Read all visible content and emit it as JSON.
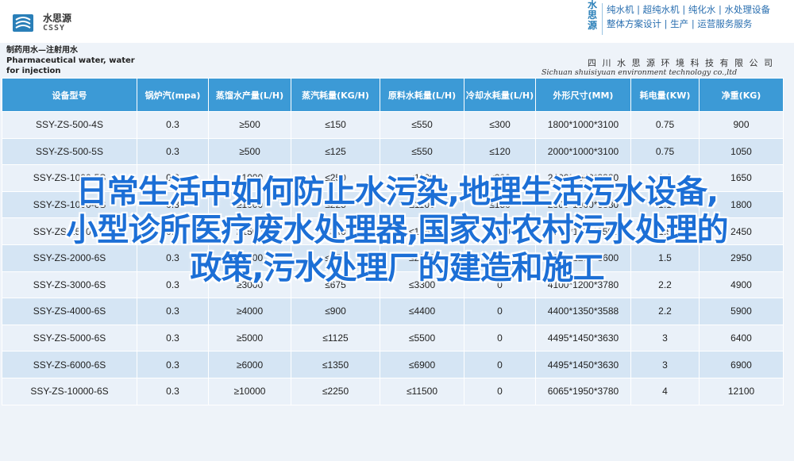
{
  "header": {
    "brand_name": "水思源",
    "brand_sub": "CSSY",
    "right_logo": "水思源",
    "right_lines": [
      "纯水机 | 超纯水机 | 纯化水 | 水处理设备",
      "整体方案设计 | 生产 | 运营服务服务"
    ]
  },
  "table": {
    "title_cn": "制药用水—注射用水",
    "title_en": "Pharmaceutical water, water for injection",
    "company_cn": "四 川 水 思 源 环 境 科 技 有 限 公 司",
    "company_en": "Sichuan shuisiyuan environment technology co.,ltd",
    "columns": [
      "设备型号",
      "锅炉汽(mpa)",
      "蒸馏水产量(L/H)",
      "蒸汽耗量(KG/H)",
      "原料水耗量(L/H)",
      "冷却水耗量(L/H)",
      "外形尺寸(MM)",
      "耗电量(KW)",
      "净重(KG)"
    ],
    "rows": [
      [
        "SSY-ZS-500-4S",
        "0.3",
        "≥500",
        "≤150",
        "≤550",
        "≤300",
        "1800*1000*3100",
        "0.75",
        "900"
      ],
      [
        "SSY-ZS-500-5S",
        "0.3",
        "≥500",
        "≤125",
        "≤550",
        "≤120",
        "2000*1000*3100",
        "0.75",
        "1050"
      ],
      [
        "SSY-ZS-1000-5S",
        "0.3",
        "≥1000",
        "≤250",
        "≤1100",
        "≤200",
        "2200*1000*3380",
        "1.1",
        "1650"
      ],
      [
        "SSY-ZS-1000-6S",
        "0.3",
        "≥1000",
        "≤225",
        "≤1100",
        "≤150",
        "2300*1000*3380",
        "1.1",
        "1800"
      ],
      [
        "SSY-ZS-1500-6S",
        "0.3",
        "≥1500",
        "≤340",
        "≤1650",
        "≤230",
        "2600*1100*3500",
        "1.5",
        "2450"
      ],
      [
        "SSY-ZS-2000-6S",
        "0.3",
        "≥2000",
        "≤450",
        "≤2200",
        "≤300",
        "3000*1200*3600",
        "1.5",
        "2950"
      ],
      [
        "SSY-ZS-3000-6S",
        "0.3",
        "≥3000",
        "≤675",
        "≤3300",
        "0",
        "4100*1200*3780",
        "2.2",
        "4900"
      ],
      [
        "SSY-ZS-4000-6S",
        "0.3",
        "≥4000",
        "≤900",
        "≤4400",
        "0",
        "4400*1350*3588",
        "2.2",
        "5900"
      ],
      [
        "SSY-ZS-5000-6S",
        "0.3",
        "≥5000",
        "≤1125",
        "≤5500",
        "0",
        "4495*1450*3630",
        "3",
        "6400"
      ],
      [
        "SSY-ZS-6000-6S",
        "0.3",
        "≥6000",
        "≤1350",
        "≤6900",
        "0",
        "4495*1450*3630",
        "3",
        "6900"
      ],
      [
        "SSY-ZS-10000-6S",
        "0.3",
        "≥10000",
        "≤2250",
        "≤11500",
        "0",
        "6065*1950*3780",
        "4",
        "12100"
      ]
    ]
  },
  "overlay_lines": [
    "日常生活中如何防止水污染,地理生活污水设备,",
    "小型诊所医疗废水处理器,国家对农村污水处理的",
    "政策,污水处理厂的建造和施工"
  ],
  "colors": {
    "header_blue": "#3c9ad6",
    "row_light": "#eaf1f9",
    "row_dark": "#d5e5f4",
    "overlay_text": "#1c6fd6"
  }
}
